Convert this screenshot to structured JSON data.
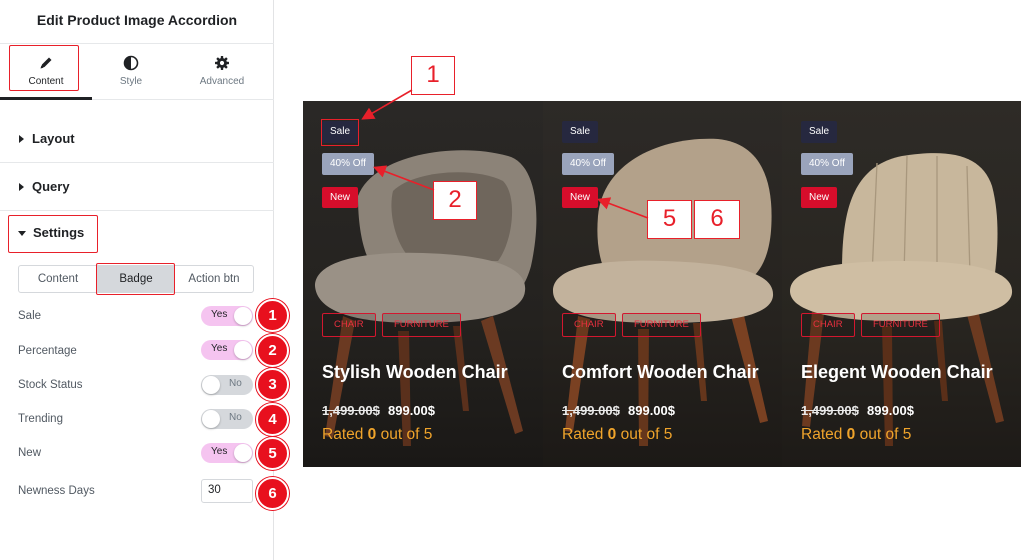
{
  "panel": {
    "title": "Edit Product Image Accordion",
    "tabs": [
      {
        "label": "Content",
        "icon": "pencil-icon"
      },
      {
        "label": "Style",
        "icon": "half-circle-icon"
      },
      {
        "label": "Advanced",
        "icon": "gear-icon"
      }
    ],
    "sections": {
      "layout": "Layout",
      "query": "Query",
      "settings": "Settings"
    },
    "subtabs": [
      "Content",
      "Badge",
      "Action btn"
    ],
    "rows": [
      {
        "label": "Sale",
        "type": "toggle",
        "state": "Yes",
        "marker": "1"
      },
      {
        "label": "Percentage",
        "type": "toggle",
        "state": "Yes",
        "marker": "2"
      },
      {
        "label": "Stock Status",
        "type": "toggle",
        "state": "No",
        "marker": "3"
      },
      {
        "label": "Trending",
        "type": "toggle",
        "state": "No",
        "marker": "4"
      },
      {
        "label": "New",
        "type": "toggle",
        "state": "Yes",
        "marker": "5"
      },
      {
        "label": "Newness Days",
        "type": "number",
        "value": "30",
        "marker": "6"
      }
    ]
  },
  "products": [
    {
      "name": "Stylish Wooden Chair",
      "badges": {
        "sale": "Sale",
        "off": "40% Off",
        "new": "New"
      },
      "categories": [
        "CHAIR",
        "FURNITURE"
      ],
      "price_old": "1,499.00$",
      "price_new": "899.00$",
      "rating_pre": "Rated ",
      "rating_value": "0",
      "rating_post": " out of 5"
    },
    {
      "name": "Comfort Wooden Chair",
      "badges": {
        "sale": "Sale",
        "off": "40% Off",
        "new": "New"
      },
      "categories": [
        "CHAIR",
        "FURNITURE"
      ],
      "price_old": "1,499.00$",
      "price_new": "899.00$",
      "rating_pre": "Rated ",
      "rating_value": "0",
      "rating_post": " out of 5"
    },
    {
      "name": "Elegent Wooden Chair",
      "badges": {
        "sale": "Sale",
        "off": "40% Off",
        "new": "New"
      },
      "categories": [
        "CHAIR",
        "FURNITURE"
      ],
      "price_old": "1,499.00$",
      "price_new": "899.00$",
      "rating_pre": "Rated ",
      "rating_value": "0",
      "rating_post": " out of 5"
    }
  ],
  "callouts": [
    "1",
    "2",
    "5",
    "6"
  ],
  "colors": {
    "annotation_red": "#e8202a",
    "toggle_on": "#f5c4f0",
    "badge_sale": "#26283f",
    "badge_off": "#9aa4bc",
    "badge_new": "#d70d2b",
    "rating": "#f0a42b"
  }
}
